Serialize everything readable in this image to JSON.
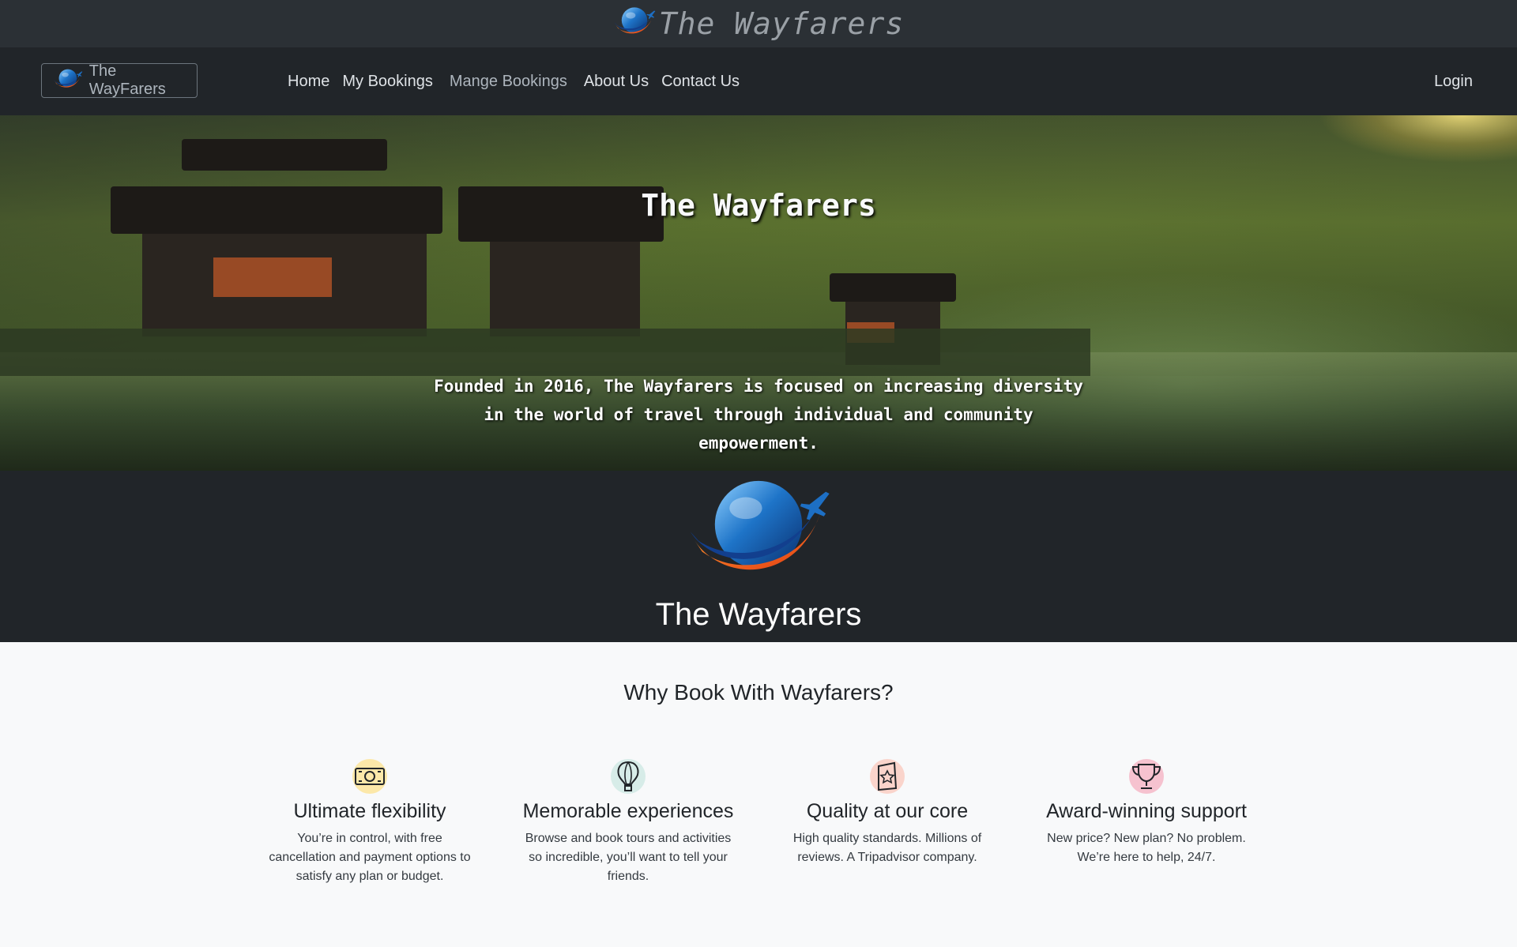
{
  "top_header": {
    "brand_title": "The Wayfarers",
    "logo_icon": "globe-plane-icon"
  },
  "navbar": {
    "brand_label": "The WayFarers",
    "links": [
      "Home",
      "My Bookings",
      "Mange Bookings",
      "About Us",
      "Contact Us"
    ],
    "login_label": "Login"
  },
  "hero": {
    "title": "The Wayfarers",
    "tagline": "Founded in 2016, The Wayfarers is focused on increasing diversity in the world of travel through individual and community empowerment."
  },
  "logo_band": {
    "title": "The Wayfarers"
  },
  "why": {
    "title": "Why Book With Wayfarers?",
    "features": [
      {
        "icon": "money-icon",
        "title": "Ultimate flexibility",
        "description": "You’re in control, with free cancellation and payment options to satisfy any plan or budget.",
        "color": "#fce8a9"
      },
      {
        "icon": "hot-air-balloon-icon",
        "title": "Memorable experiences",
        "description": "Browse and book tours and activities so incredible, you’ll want to tell your friends.",
        "color": "#d7ece8"
      },
      {
        "icon": "badge-star-icon",
        "title": "Quality at our core",
        "description": "High quality standards. Millions of reviews. A Tripadvisor company.",
        "color": "#fad4cb"
      },
      {
        "icon": "trophy-icon",
        "title": "Award-winning support",
        "description": "New price? New plan? No problem. We’re here to help, 24/7.",
        "color": "#f6c2cf"
      }
    ]
  },
  "colors": {
    "header": "#2b3035",
    "navbar": "#212529",
    "page": "#f8f9fa",
    "accent_blue": "#1d6fc4",
    "accent_orange": "#f07a1e"
  }
}
